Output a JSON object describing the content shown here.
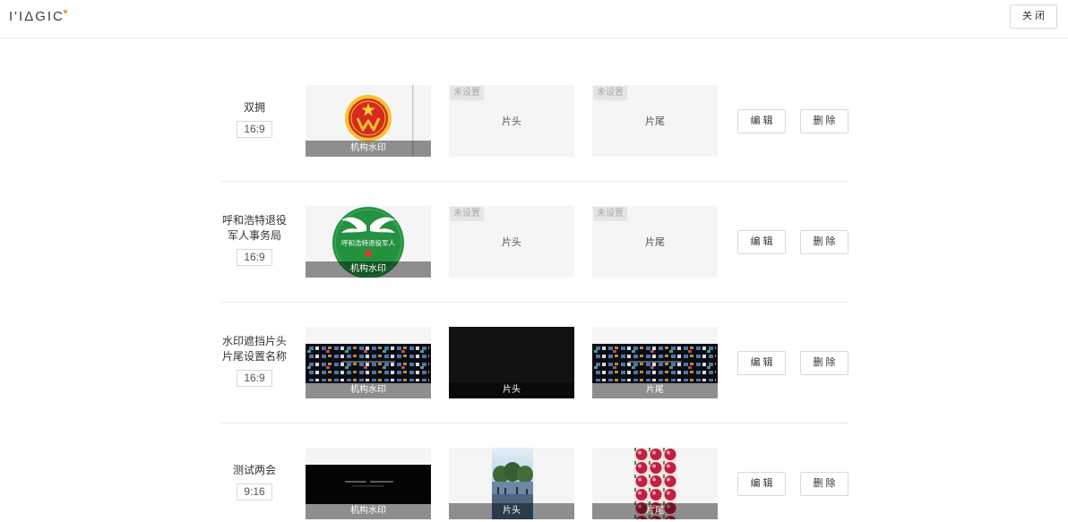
{
  "header": {
    "logo_text": "I'IΔGIC",
    "close_label": "关 闭"
  },
  "colors": {
    "card_bg": "#f5f5f5",
    "border": "#d9d9d9",
    "divider": "#e8e8e8",
    "label_overlay": "rgba(0,0,0,0.42)",
    "logo_dot": "#f0a030"
  },
  "rows": [
    {
      "name": "双拥",
      "ratio": "16:9",
      "watermark": {
        "label": "机构水印"
      },
      "opening": {
        "status": "未设置",
        "label": "片头"
      },
      "ending": {
        "status": "未设置",
        "label": "片尾"
      },
      "edit_label": "编 辑",
      "delete_label": "删 除"
    },
    {
      "name": "呼和浩特退役军人事务局",
      "ratio": "16:9",
      "watermark": {
        "label": "机构水印",
        "image_text": "呼和浩特退役军人"
      },
      "opening": {
        "status": "未设置",
        "label": "片头"
      },
      "ending": {
        "status": "未设置",
        "label": "片尾"
      },
      "edit_label": "编 辑",
      "delete_label": "删 除"
    },
    {
      "name": "水印遮挡片头片尾设置名称",
      "ratio": "16:9",
      "watermark": {
        "label": "机构水印"
      },
      "opening": {
        "label": "片头"
      },
      "ending": {
        "label": "片尾"
      },
      "edit_label": "编 辑",
      "delete_label": "删 除"
    },
    {
      "name": "测试两会",
      "ratio": "9:16",
      "watermark": {
        "label": "机构水印"
      },
      "opening": {
        "label": "片头"
      },
      "ending": {
        "label": "片尾"
      },
      "edit_label": "编 辑",
      "delete_label": "删 除"
    }
  ]
}
